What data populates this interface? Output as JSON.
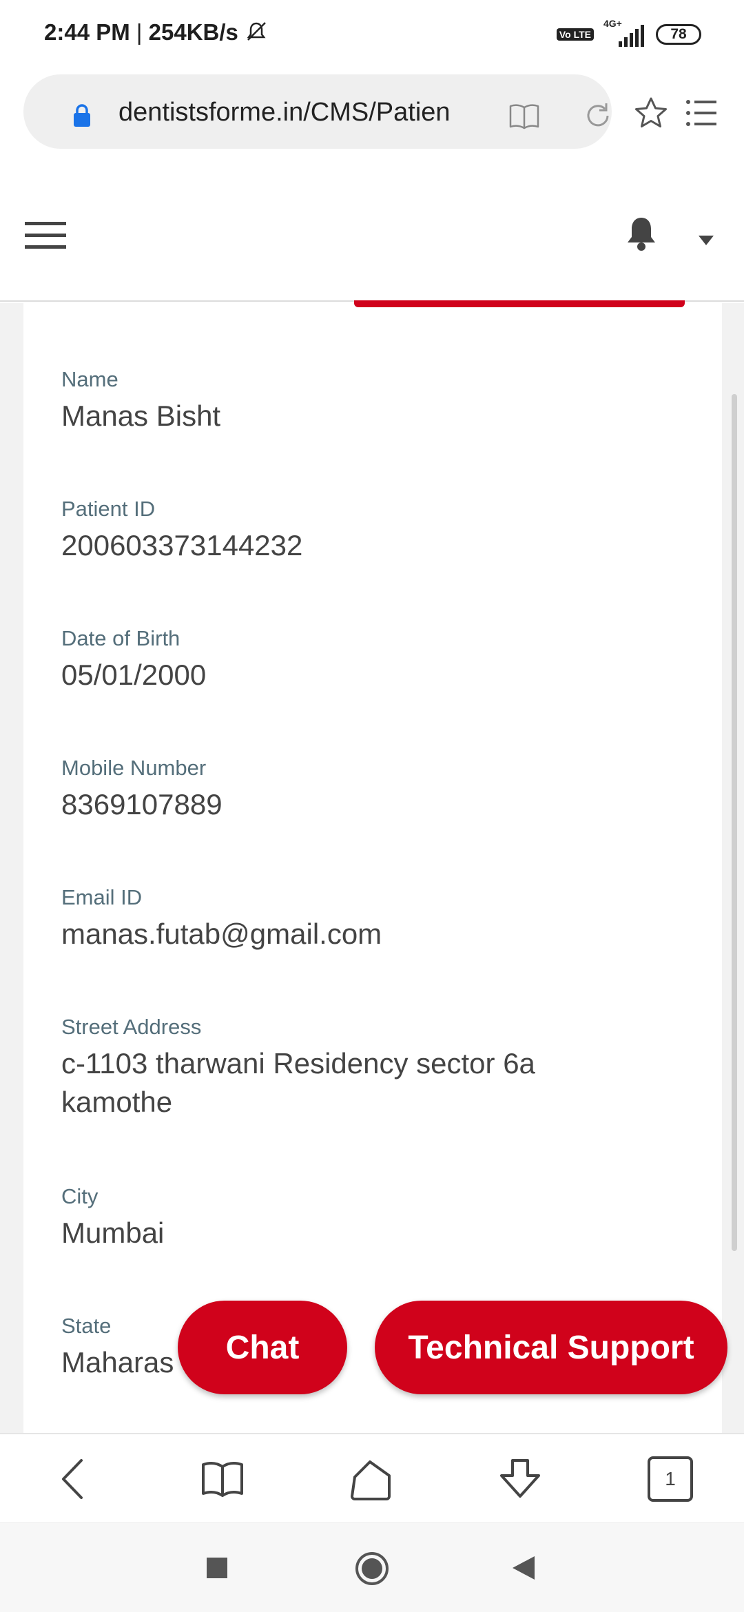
{
  "status_bar": {
    "time": "2:44 PM",
    "separator": "|",
    "speed": "254KB/s",
    "network": "4G+",
    "volte": "Vo LTE",
    "battery": "78"
  },
  "browser": {
    "url": "dentistsforme.in/CMS/Patien",
    "icons": [
      "lock-icon",
      "reader-mode-icon",
      "reload-icon",
      "bookmark-star-icon",
      "menu-list-icon"
    ]
  },
  "header": {
    "icons": [
      "hamburger-menu-icon",
      "notification-bell-icon",
      "dropdown-caret-icon"
    ]
  },
  "profile": {
    "fields": [
      {
        "label": "Name",
        "value": "Manas Bisht"
      },
      {
        "label": "Patient ID",
        "value": "200603373144232"
      },
      {
        "label": "Date of Birth",
        "value": "05/01/2000"
      },
      {
        "label": "Mobile Number",
        "value": "8369107889"
      },
      {
        "label": "Email ID",
        "value": "manas.futab@gmail.com"
      },
      {
        "label": "Street Address",
        "value_line1": "c-1103 tharwani Residency sector 6a",
        "value_line2": "kamothe"
      },
      {
        "label": "City",
        "value": "Mumbai"
      },
      {
        "label": "State",
        "value": "Maharas"
      }
    ]
  },
  "floating_buttons": {
    "chat": "Chat",
    "technical_support": "Technical Support"
  },
  "bottom_nav": {
    "tab_count": "1"
  },
  "colors": {
    "accent": "#d0021b",
    "label": "#546e7a",
    "value": "#444444",
    "lock": "#1a73e8"
  }
}
